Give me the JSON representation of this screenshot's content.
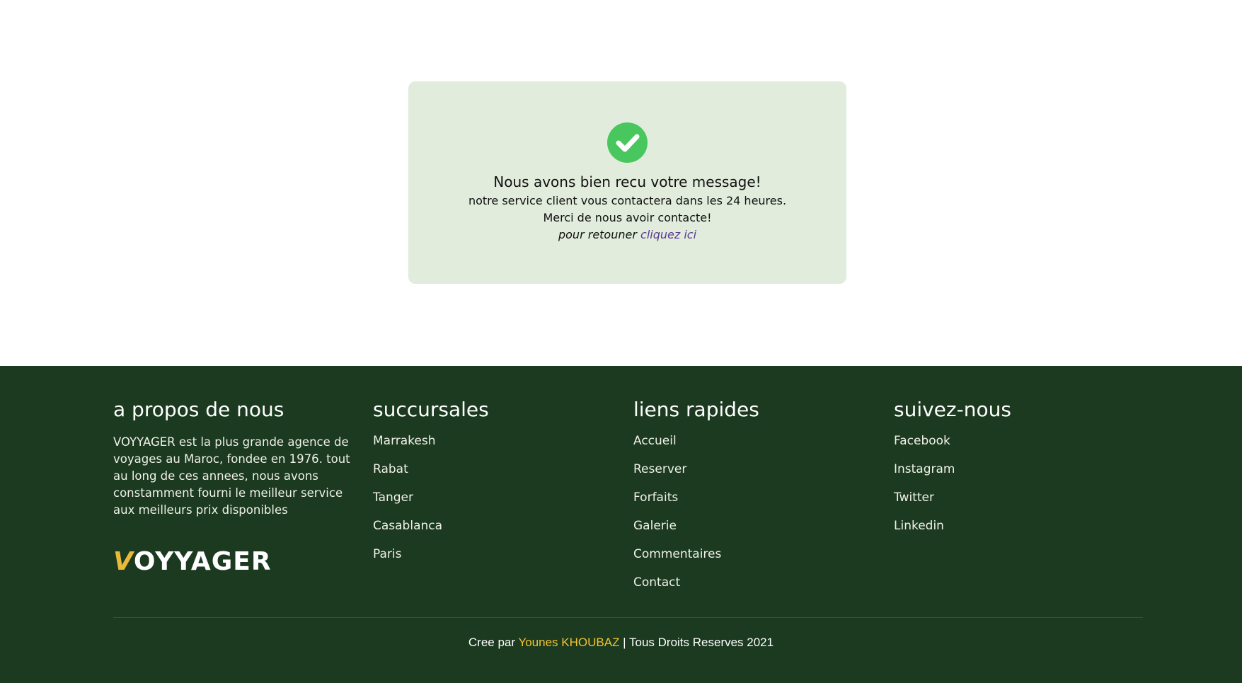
{
  "confirmation": {
    "icon": "check-circle-icon",
    "title": "Nous avons bien recu votre message!",
    "line1": "notre service client vous contactera dans les 24 heures.",
    "line2": "Merci de nous avoir contacte!",
    "return_text": "pour retouner",
    "return_link": "cliquez ici"
  },
  "footer": {
    "about": {
      "heading": "a propos de nous",
      "text": "VOYYAGER est la plus grande agence de voyages au Maroc, fondee en 1976. tout au long de ces annees, nous avons constamment fourni le meilleur service aux meilleurs prix disponibles",
      "logo_text": "VOYYAGER"
    },
    "branches": {
      "heading": "succursales",
      "items": [
        "Marrakesh",
        "Rabat",
        "Tanger",
        "Casablanca",
        "Paris"
      ]
    },
    "quick_links": {
      "heading": "liens rapides",
      "items": [
        "Accueil",
        "Reserver",
        "Forfaits",
        "Galerie",
        "Commentaires",
        "Contact"
      ]
    },
    "follow": {
      "heading": "suivez-nous",
      "items": [
        "Facebook",
        "Instagram",
        "Twitter",
        "Linkedin"
      ]
    },
    "copyright": {
      "prefix": "Cree par",
      "author": "Younes KHOUBAZ",
      "suffix": "| Tous Droits Reserves 2021"
    }
  },
  "colors": {
    "footer_bg": "#1b3a1f",
    "accent": "#f4c430",
    "check": "#48c75e",
    "card_bg": "#e1ecdc"
  }
}
